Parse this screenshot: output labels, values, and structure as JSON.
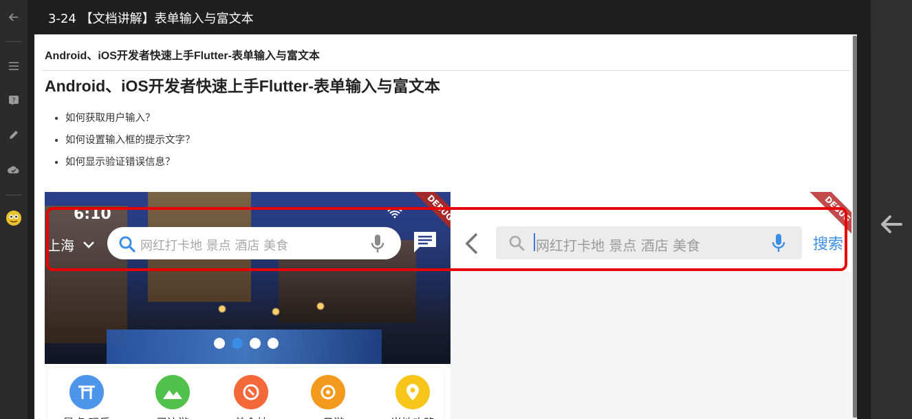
{
  "topbar": {
    "title": "3-24 【文档讲解】表单输入与富文本"
  },
  "document": {
    "header": "Android、iOS开发者快速上手Flutter-表单输入与富文本",
    "h1": "Android、iOS开发者快速上手Flutter-表单输入与富文本",
    "bullets": [
      "如何获取用户输入？",
      "如何设置输入框的提示文字？",
      "如何显示验证错误信息？"
    ]
  },
  "screenshot_home": {
    "time": "6:10",
    "city": "上海",
    "search_placeholder": "网红打卡地 景点 酒店 美食",
    "debug_ribbon": "DEBUG",
    "carousel_active_index": 1,
    "grid_items": [
      "景点·玩乐",
      "周边游",
      "美食林",
      "一日游",
      "当地攻略"
    ]
  },
  "screenshot_search": {
    "search_placeholder": "网红打卡地 景点 酒店 美食",
    "search_button": "搜索",
    "debug_ribbon": "DEBUG"
  },
  "colors": {
    "highlight": "#e80000",
    "accent": "#3a8ee6"
  },
  "icons": [
    "back-arrow-icon",
    "menu-icon",
    "help-icon",
    "edit-icon",
    "cloud-icon",
    "avatar-icon",
    "next-arrow-icon",
    "search-icon",
    "mic-icon",
    "message-icon",
    "chevron-down-icon",
    "wifi-icon",
    "battery-icon"
  ]
}
